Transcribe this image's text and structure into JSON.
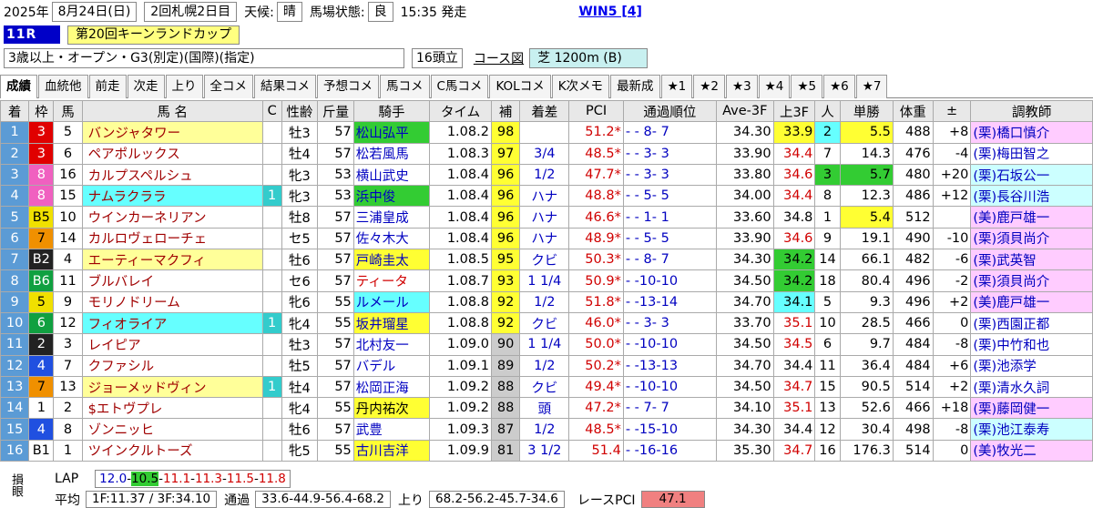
{
  "header": {
    "date": "2025年",
    "date_md": "8月24日(日)",
    "meet": "2回札幌2日目",
    "weather_label": "天候:",
    "weather": "晴",
    "track_label": "馬場状態:",
    "track": "良",
    "start": "15:35 発走",
    "win5": "WIN5 [4]"
  },
  "race": {
    "num": "11R",
    "name": "第20回キーンランドカップ",
    "cond": "3歳以上・オープン・G3(別定)(国際)(指定)",
    "heads": "16頭立",
    "course_link": "コース図",
    "surface": "芝 1200m (B)"
  },
  "tabs": [
    "成績",
    "血統他",
    "前走",
    "次走",
    "上り",
    "全コメ",
    "結果コメ",
    "予想コメ",
    "馬コメ",
    "C馬コメ",
    "KOLコメ",
    "K次メモ",
    "最新成",
    "★1",
    "★2",
    "★3",
    "★4",
    "★5",
    "★6",
    "★7"
  ],
  "columns": [
    "着",
    "枠",
    "馬",
    "馬 名",
    "C",
    "性齢",
    "斤量",
    "騎手",
    "タイム",
    "補",
    "着差",
    "PCI",
    "通過順位",
    "Ave-3F",
    "上3F",
    "人",
    "単勝",
    "体重",
    "±",
    "調教師"
  ],
  "rows": [
    [
      "1",
      "3",
      "5",
      "バンジャタワー",
      "",
      "牡3",
      "57",
      "松山弘平",
      "1.08.2",
      "98",
      "",
      "51.2*",
      "- - 8- 7",
      "34.30",
      "33.9",
      "2",
      "5.5",
      "488",
      "+8",
      "(栗)橋口慎介"
    ],
    [
      "2",
      "3",
      "6",
      "ペアポルックス",
      "",
      "牡4",
      "57",
      "松若風馬",
      "1.08.3",
      "97",
      "3/4",
      "48.5*",
      "- - 3- 3",
      "33.90",
      "34.4",
      "7",
      "14.3",
      "476",
      "-4",
      "(栗)梅田智之"
    ],
    [
      "3",
      "8",
      "16",
      "カルプスペルシュ",
      "",
      "牝3",
      "53",
      "横山武史",
      "1.08.4",
      "96",
      "1/2",
      "47.7*",
      "- - 3- 3",
      "33.80",
      "34.6",
      "3",
      "5.7",
      "480",
      "+20",
      "(栗)石坂公一"
    ],
    [
      "4",
      "8",
      "15",
      "ナムラクララ",
      "1",
      "牝3",
      "53",
      "浜中俊",
      "1.08.4",
      "96",
      "ハナ",
      "48.8*",
      "- - 5- 5",
      "34.00",
      "34.4",
      "8",
      "12.3",
      "486",
      "+12",
      "(栗)長谷川浩"
    ],
    [
      "5",
      "B5",
      "10",
      "ウインカーネリアン",
      "",
      "牡8",
      "57",
      "三浦皇成",
      "1.08.4",
      "96",
      "ハナ",
      "46.6*",
      "- - 1- 1",
      "33.60",
      "34.8",
      "1",
      "5.4",
      "512",
      "",
      "(美)鹿戸雄一"
    ],
    [
      "6",
      "7",
      "14",
      "カルロヴェローチェ",
      "",
      "セ5",
      "57",
      "佐々木大",
      "1.08.4",
      "96",
      "ハナ",
      "48.9*",
      "- - 5- 5",
      "33.90",
      "34.6",
      "9",
      "19.1",
      "490",
      "-10",
      "(栗)須貝尚介"
    ],
    [
      "7",
      "B2",
      "4",
      "エーティーマクフィ",
      "",
      "牡6",
      "57",
      "戸崎圭太",
      "1.08.5",
      "95",
      "クビ",
      "50.3*",
      "- - 8- 7",
      "34.30",
      "34.2",
      "14",
      "66.1",
      "482",
      "-6",
      "(栗)武英智"
    ],
    [
      "8",
      "B6",
      "11",
      "ブルバレイ",
      "",
      "セ6",
      "57",
      "ティータ",
      "1.08.7",
      "93",
      "1 1/4",
      "50.9*",
      "- -10-10",
      "34.50",
      "34.2",
      "18",
      "80.4",
      "496",
      "-2",
      "(栗)須貝尚介"
    ],
    [
      "9",
      "5",
      "9",
      "モリノドリーム",
      "",
      "牝6",
      "55",
      "ルメール",
      "1.08.8",
      "92",
      "1/2",
      "51.8*",
      "- -13-14",
      "34.70",
      "34.1",
      "5",
      "9.3",
      "496",
      "+2",
      "(美)鹿戸雄一"
    ],
    [
      "10",
      "6",
      "12",
      "フィオライア",
      "1",
      "牝4",
      "55",
      "坂井瑠星",
      "1.08.8",
      "92",
      "クビ",
      "46.0*",
      "- - 3- 3",
      "33.70",
      "35.1",
      "10",
      "28.5",
      "466",
      "0",
      "(栗)西園正都"
    ],
    [
      "11",
      "2",
      "3",
      "レイピア",
      "",
      "牡3",
      "57",
      "北村友一",
      "1.09.0",
      "90",
      "1 1/4",
      "50.0*",
      "- -10-10",
      "34.50",
      "34.5",
      "6",
      "9.7",
      "484",
      "-8",
      "(栗)中竹和也"
    ],
    [
      "12",
      "4",
      "7",
      "クファシル",
      "",
      "牡5",
      "57",
      "バデル",
      "1.09.1",
      "89",
      "1/2",
      "50.2*",
      "- -13-13",
      "34.70",
      "34.4",
      "11",
      "36.4",
      "484",
      "+6",
      "(栗)池添学"
    ],
    [
      "13",
      "7",
      "13",
      "ジョーメッドヴィン",
      "1",
      "牡4",
      "57",
      "松岡正海",
      "1.09.2",
      "88",
      "クビ",
      "49.4*",
      "- -10-10",
      "34.50",
      "34.7",
      "15",
      "90.5",
      "514",
      "+2",
      "(栗)清水久詞"
    ],
    [
      "14",
      "1",
      "2",
      "$エトヴプレ",
      "",
      "牝4",
      "55",
      "丹内祐次",
      "1.09.2",
      "88",
      "頭",
      "47.2*",
      "- - 7- 7",
      "34.10",
      "35.1",
      "13",
      "52.6",
      "466",
      "+18",
      "(栗)藤岡健一"
    ],
    [
      "15",
      "4",
      "8",
      "ゾンニッヒ",
      "",
      "牡6",
      "57",
      "武豊",
      "1.09.3",
      "87",
      "1/2",
      "48.5*",
      "- -15-10",
      "34.30",
      "34.4",
      "12",
      "30.4",
      "498",
      "-8",
      "(栗)池江泰寿"
    ],
    [
      "16",
      "B1",
      "1",
      "ツインクルトーズ",
      "",
      "牝5",
      "55",
      "古川吉洋",
      "1.09.9",
      "81",
      "3 1/2",
      "51.4",
      "- -16-16",
      "35.30",
      "34.7",
      "16",
      "176.3",
      "514",
      "0",
      "(美)牧光二"
    ]
  ],
  "footer": {
    "vlabel": "損眼",
    "lap_label": "LAP",
    "lap": [
      "12.0",
      "10.5",
      "11.1",
      "11.3",
      "11.5",
      "11.8"
    ],
    "avg_label": "平均",
    "avg": "1F:11.37 / 3F:34.10",
    "pass_label": "通過",
    "pass": "33.6-44.9-56.4-68.2",
    "up_label": "上り",
    "up": "68.2-56.2-45.7-34.6",
    "race_pci_label": "レースPCI",
    "race_pci": "47.1"
  }
}
